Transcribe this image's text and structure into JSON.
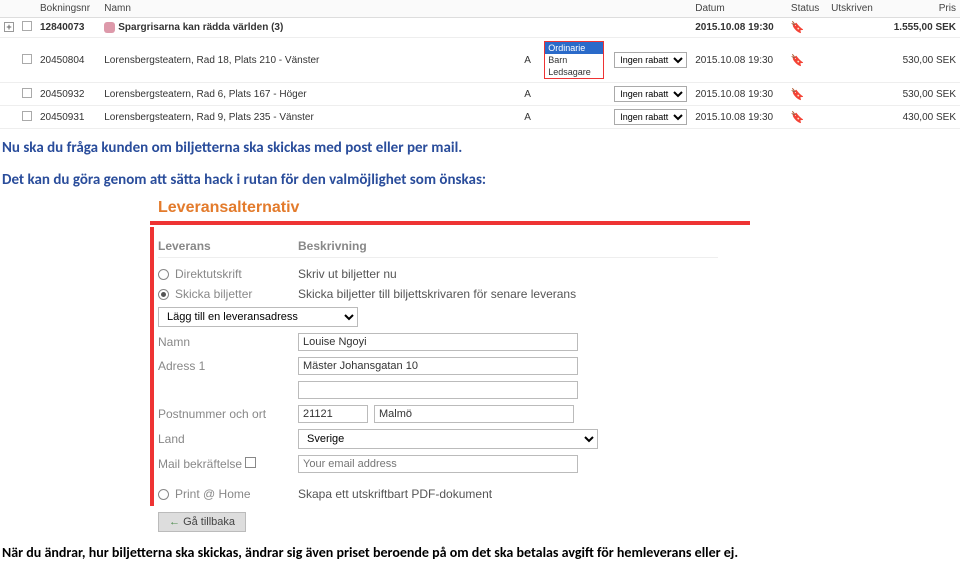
{
  "table": {
    "headers": [
      "",
      "",
      "Bokningsnr",
      "Namn",
      "",
      "",
      "",
      "Datum",
      "Status",
      "Utskriven",
      "Pris"
    ],
    "rows": [
      {
        "expand": "+",
        "bnr": "12840073",
        "pig": true,
        "namn": "Spargrisarna kan rädda världen (3)",
        "a": "",
        "ord": "",
        "rabatt": "",
        "datum": "2015.10.08 19:30",
        "tag": true,
        "utskr": "",
        "pris": "1.555,00 SEK",
        "bold": true
      },
      {
        "expand": "",
        "bnr": "20450804",
        "pig": false,
        "namn": "Lorensbergsteatern, Rad 18, Plats 210 - Vänster",
        "a": "A",
        "ord": "Ordinarie",
        "rabatt": "Ingen rabatt",
        "datum": "2015.10.08 19:30",
        "tag": true,
        "utskr": "",
        "pris": "530,00 SEK",
        "bold": false,
        "ddopen": true
      },
      {
        "expand": "",
        "bnr": "20450932",
        "pig": false,
        "namn": "Lorensbergsteatern, Rad 6, Plats 167 - Höger",
        "a": "A",
        "ord": "",
        "rabatt": "Ingen rabatt",
        "datum": "2015.10.08 19:30",
        "tag": true,
        "utskr": "",
        "pris": "530,00 SEK",
        "bold": false
      },
      {
        "expand": "",
        "bnr": "20450931",
        "pig": false,
        "namn": "Lorensbergsteatern, Rad 9, Plats 235 - Vänster",
        "a": "A",
        "ord": "",
        "rabatt": "Ingen rabatt",
        "datum": "2015.10.08 19:30",
        "tag": true,
        "utskr": "",
        "pris": "430,00 SEK",
        "bold": false
      }
    ],
    "dd_options": [
      "Ordinarie",
      "Barn",
      "Ledsagare"
    ]
  },
  "instr1": "Nu ska du fråga kunden om biljetterna ska skickas med post eller per mail.",
  "instr2": "Det kan du göra genom att sätta hack i rutan för den valmöjlighet som önskas:",
  "delivery": {
    "title": "Leveransalternativ",
    "col1": "Leverans",
    "col2": "Beskrivning",
    "opts": [
      {
        "label": "Direktutskrift",
        "desc": "Skriv ut biljetter nu",
        "on": false
      },
      {
        "label": "Skicka biljetter",
        "desc": "Skicka biljetter till biljettskrivaren för senare leverans",
        "on": true
      }
    ],
    "add_addr": "Lägg till en leveransadress",
    "name_lbl": "Namn",
    "name_val": "Louise Ngoyi",
    "addr_lbl": "Adress 1",
    "addr_val": "Mäster Johansgatan 10",
    "post_lbl": "Postnummer och ort",
    "post_val": "21121",
    "city_val": "Malmö",
    "land_lbl": "Land",
    "land_val": "Sverige",
    "mail_lbl": "Mail bekräftelse",
    "mail_ph": "Your email address",
    "print_lbl": "Print @ Home",
    "print_desc": "Skapa ett utskriftbart PDF-dokument",
    "back": "Gå tillbaka"
  },
  "footer": "När du ändrar, hur biljetterna ska skickas, ändrar sig även priset beroende på om det ska betalas avgift för hemleverans eller ej."
}
